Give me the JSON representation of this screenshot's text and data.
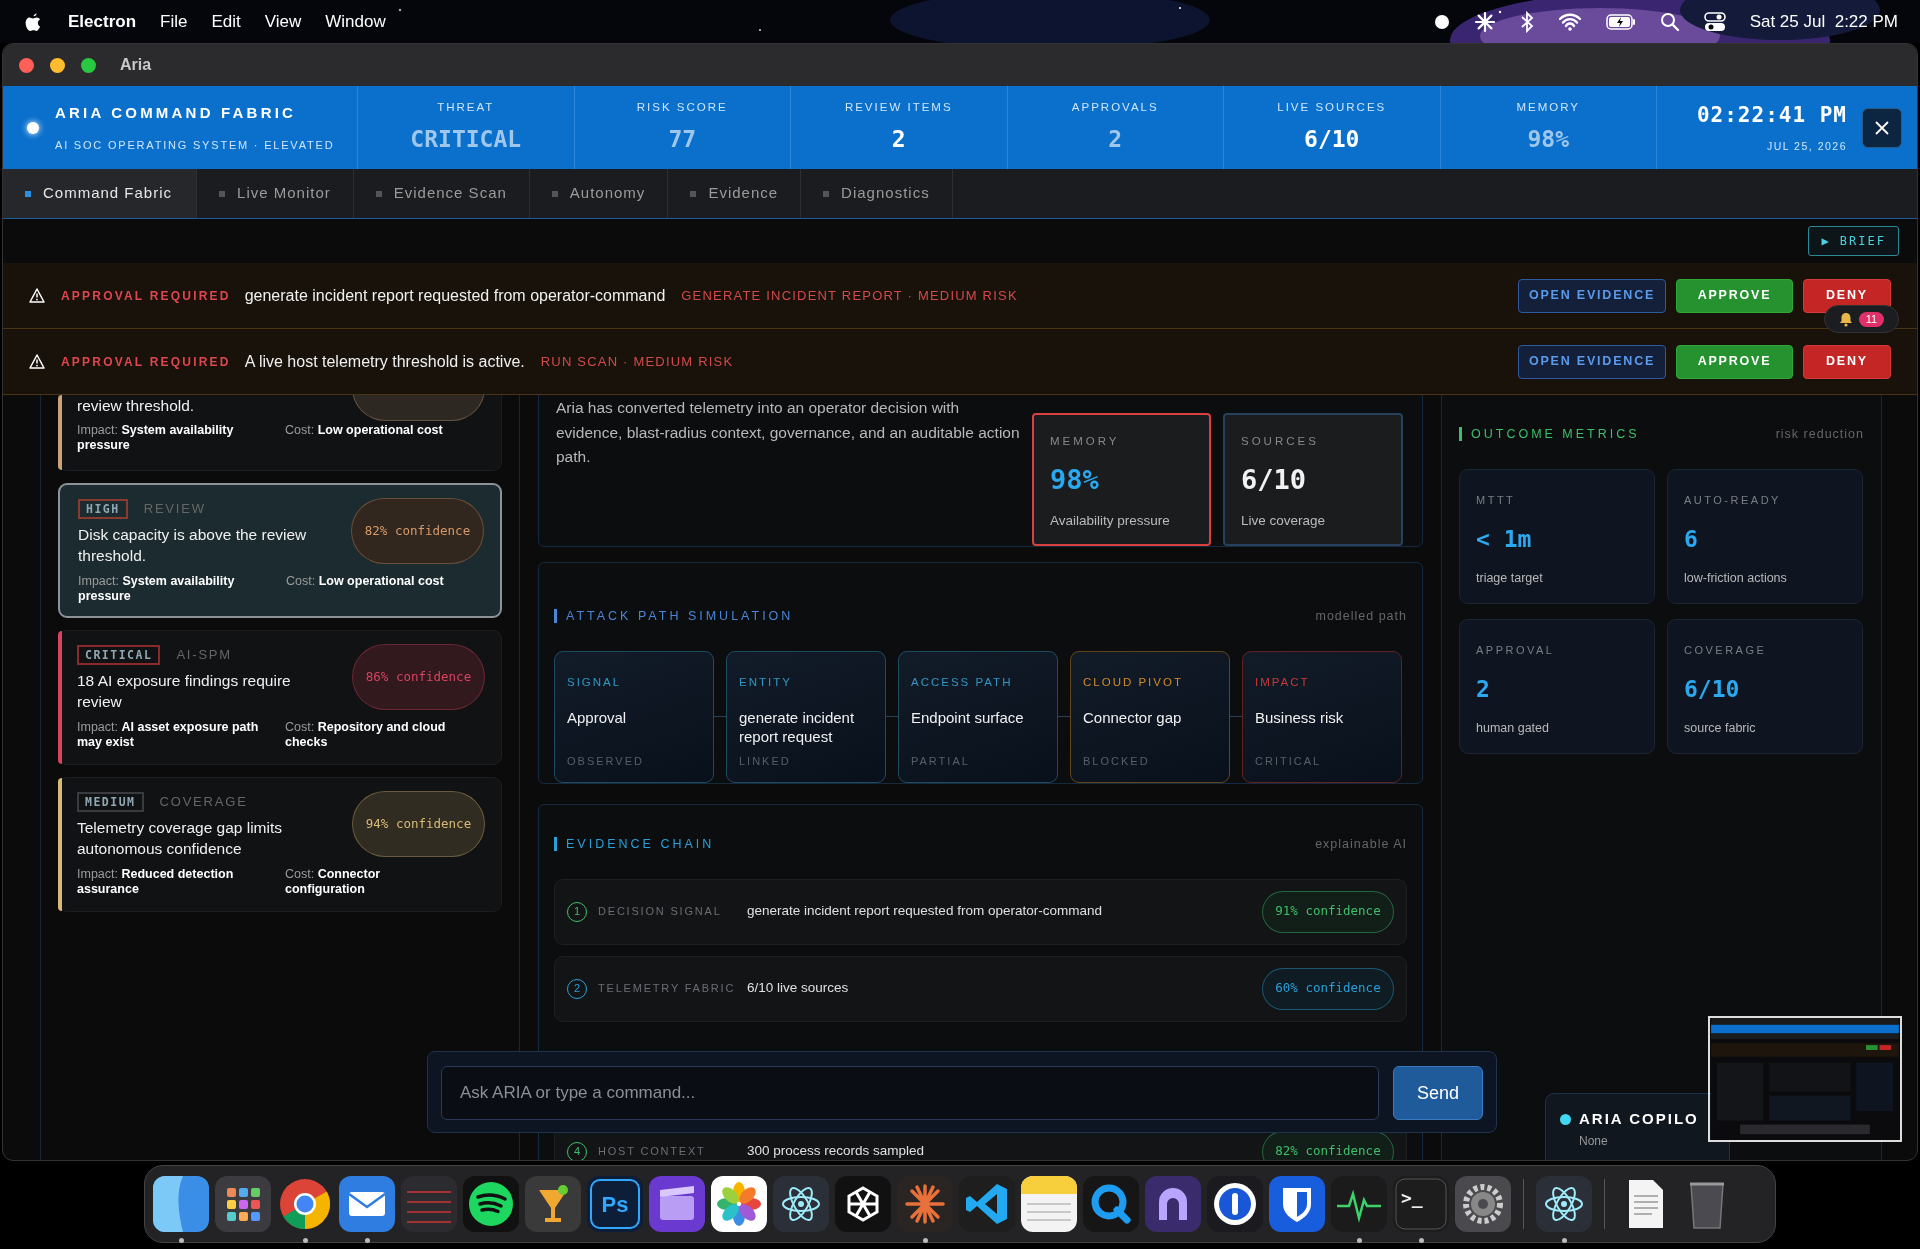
{
  "menubar": {
    "app": "Electron",
    "menus": [
      "File",
      "Edit",
      "View",
      "Window"
    ],
    "clock": "Sat 25 Jul  2:22 PM"
  },
  "window": {
    "title": "Aria"
  },
  "header": {
    "title": "ARIA COMMAND FABRIC",
    "subtitle": "AI SOC OPERATING SYSTEM · ELEVATED",
    "stats": [
      {
        "label": "THREAT",
        "value": "CRITICAL",
        "highlighted": false
      },
      {
        "label": "RISK SCORE",
        "value": "77",
        "highlighted": false
      },
      {
        "label": "REVIEW ITEMS",
        "value": "2",
        "highlighted": true
      },
      {
        "label": "APPROVALS",
        "value": "2",
        "highlighted": false
      },
      {
        "label": "LIVE SOURCES",
        "value": "6/10",
        "highlighted": true
      },
      {
        "label": "MEMORY",
        "value": "98%",
        "highlighted": false
      }
    ],
    "time": "02:22:41 PM",
    "date": "JUL 25, 2026"
  },
  "tabs": [
    {
      "label": "Command Fabric",
      "selected": true
    },
    {
      "label": "Live Monitor",
      "selected": false
    },
    {
      "label": "Evidence Scan",
      "selected": false
    },
    {
      "label": "Autonomy",
      "selected": false
    },
    {
      "label": "Evidence",
      "selected": false
    },
    {
      "label": "Diagnostics",
      "selected": false
    }
  ],
  "brief_button": "▶ BRIEF",
  "approvals": [
    {
      "label": "APPROVAL REQUIRED",
      "message": "generate incident report requested from operator-command",
      "detail": "GENERATE INCIDENT REPORT · MEDIUM RISK",
      "buttons": [
        "OPEN EVIDENCE",
        "APPROVE",
        "DENY"
      ]
    },
    {
      "label": "APPROVAL REQUIRED",
      "message": "A live host telemetry threshold is active.",
      "detail": "RUN SCAN · MEDIUM RISK",
      "buttons": [
        "OPEN EVIDENCE",
        "APPROVE",
        "DENY"
      ]
    }
  ],
  "notifications": {
    "count": "11"
  },
  "findings": [
    {
      "title": "review threshold.",
      "impact": "Impact: **System availability pressure**",
      "cost": "Cost: **Low operational cost**",
      "color": "#c9a27a",
      "selected": false
    },
    {
      "severity": {
        "label": "HIGH",
        "color": "#8a3b30"
      },
      "category": "REVIEW",
      "title": "Disk capacity is above the review threshold.",
      "confidence": "82% confidence",
      "impact": "Impact: **System availability pressure**",
      "cost": "Cost: **Low operational cost**",
      "color": "#d99a6a",
      "selected": true
    },
    {
      "severity": {
        "label": "CRITICAL",
        "color": "#8a2a2a"
      },
      "category": "AI-SPM",
      "title": "18 AI exposure findings require review",
      "confidence": "86% confidence",
      "impact": "Impact: **AI asset exposure path may exist**",
      "cost": "Cost: **Repository and cloud checks**",
      "color": "#d9435f",
      "selected": false
    },
    {
      "severity": {
        "label": "MEDIUM",
        "color": "#3a3b3e"
      },
      "category": "COVERAGE",
      "title": "Telemetry coverage gap limits autonomous confidence",
      "confidence": "94% confidence",
      "impact": "Impact: **Reduced detection assurance**",
      "cost": "Cost: **Connector configuration**",
      "color": "#d8bb78",
      "selected": false
    }
  ],
  "summary": {
    "text": "Aria has converted telemetry into an operator decision with evidence, blast-radius context, governance, and an auditable action path.",
    "cards": [
      {
        "label": "MEMORY",
        "value": "98%",
        "caption": "Availability pressure",
        "color": "#d94040",
        "highlighted": true
      },
      {
        "label": "SOURCES",
        "value": "6/10",
        "caption": "Live coverage",
        "color": "#26405e",
        "highlighted": false
      }
    ]
  },
  "attack_path": {
    "title": "ATTACK PATH SIMULATION",
    "note": "modelled path",
    "nodes": [
      {
        "label": "SIGNAL",
        "title": "Approval",
        "status": "OBSERVED",
        "color": "#3196c4"
      },
      {
        "label": "ENTITY",
        "title": "generate incident report request",
        "status": "LINKED",
        "color": "#3196c4"
      },
      {
        "label": "ACCESS PATH",
        "title": "Endpoint surface",
        "status": "PARTIAL",
        "color": "#3196c4"
      },
      {
        "label": "CLOUD PIVOT",
        "title": "Connector gap",
        "status": "BLOCKED",
        "color": "#d08a2a"
      },
      {
        "label": "IMPACT",
        "title": "Business risk",
        "status": "CRITICAL",
        "color": "#c83a3a"
      }
    ]
  },
  "evidence_chain": {
    "title": "EVIDENCE CHAIN",
    "note": "explainable AI",
    "steps": [
      {
        "number": "1",
        "label": "DECISION SIGNAL",
        "text": "generate incident report requested from operator-command",
        "confidence": "91% confidence",
        "color": "#3fbf6a"
      },
      {
        "number": "2",
        "label": "TELEMETRY FABRIC",
        "text": "6/10 live sources",
        "confidence": "60% confidence",
        "color": "#2a9fd8"
      },
      {
        "number": "4",
        "label": "HOST CONTEXT",
        "text": "300 process records sampled",
        "confidence": "82% confidence",
        "color": "#3fbf6a"
      }
    ]
  },
  "outcome_metrics": {
    "title": "OUTCOME METRICS",
    "note": "risk reduction",
    "metrics": [
      {
        "label": "MTTT",
        "value": "< 1m",
        "caption": "triage target"
      },
      {
        "label": "AUTO-READY",
        "value": "6",
        "caption": "low-friction actions"
      },
      {
        "label": "APPROVAL",
        "value": "2",
        "caption": "human gated"
      },
      {
        "label": "COVERAGE",
        "value": "6/10",
        "caption": "source fabric"
      }
    ]
  },
  "chat": {
    "placeholder": "Ask ARIA or type a command...",
    "button": "Send"
  },
  "copilot": {
    "title": "ARIA COPILO",
    "status": "None"
  },
  "dock": [
    [
      {
        "running": true
      },
      {
        "running": false
      },
      {
        "running": true
      },
      {
        "running": true
      },
      {
        "running": false
      },
      {
        "running": false
      },
      {
        "running": false
      },
      {
        "running": false,
        "glyph": "Ps"
      },
      {
        "running": false
      },
      {
        "running": false
      },
      {
        "running": false
      },
      {
        "running": false
      },
      {
        "running": true
      },
      {
        "running": false
      },
      {
        "running": false
      },
      {
        "running": false
      },
      {
        "running": false
      },
      {
        "running": false
      },
      {
        "running": false
      },
      {
        "running": true
      },
      {
        "running": true,
        "glyph": ">_"
      },
      {
        "running": false
      }
    ],
    [
      {
        "running": true
      }
    ],
    [
      {
        "running": false
      },
      {
        "running": false
      }
    ]
  ]
}
